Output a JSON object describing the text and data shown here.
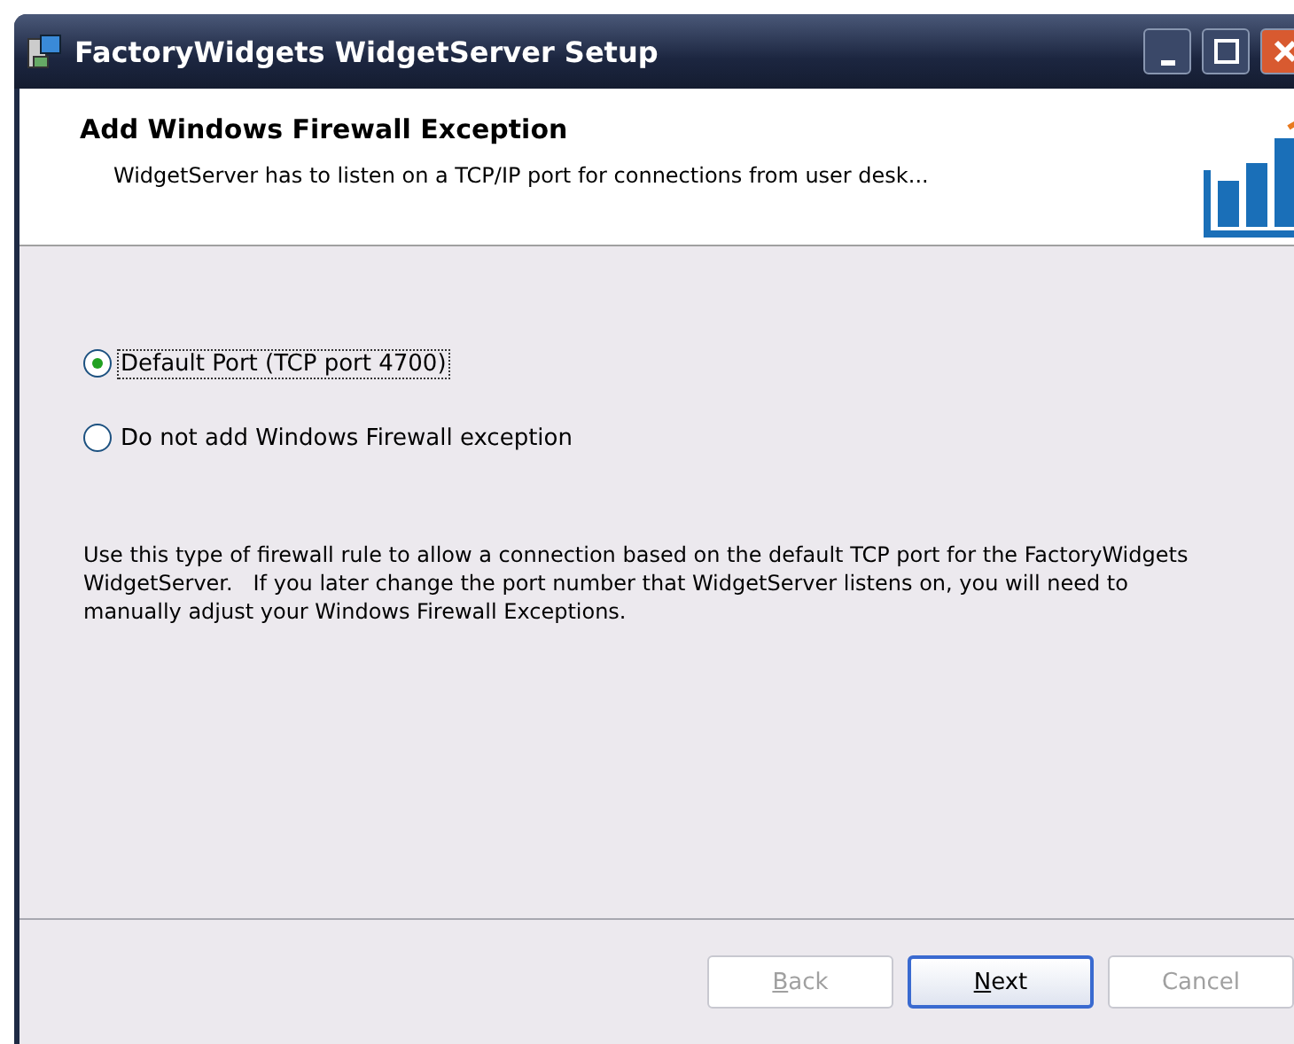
{
  "window": {
    "title": "FactoryWidgets WidgetServer Setup"
  },
  "header": {
    "title": "Add Windows Firewall Exception",
    "subtitle": "WidgetServer has to listen on a TCP/IP port for connections from user desk..."
  },
  "options": [
    {
      "label": "Default Port (TCP port 4700)",
      "selected": true
    },
    {
      "label": "Do not add Windows Firewall exception",
      "selected": false
    }
  ],
  "description": "Use this type of firewall rule to allow a connection based on the default TCP port for the FactoryWidgets WidgetServer.   If you later change the port number that WidgetServer listens on, you will need to manually adjust your Windows Firewall Exceptions.",
  "buttons": [
    {
      "label": "Back",
      "disabled": true,
      "default": false,
      "mnemonic": true
    },
    {
      "label": "Next",
      "disabled": false,
      "default": true,
      "mnemonic": true
    },
    {
      "label": "Cancel",
      "disabled": true,
      "default": false,
      "mnemonic": false
    }
  ]
}
